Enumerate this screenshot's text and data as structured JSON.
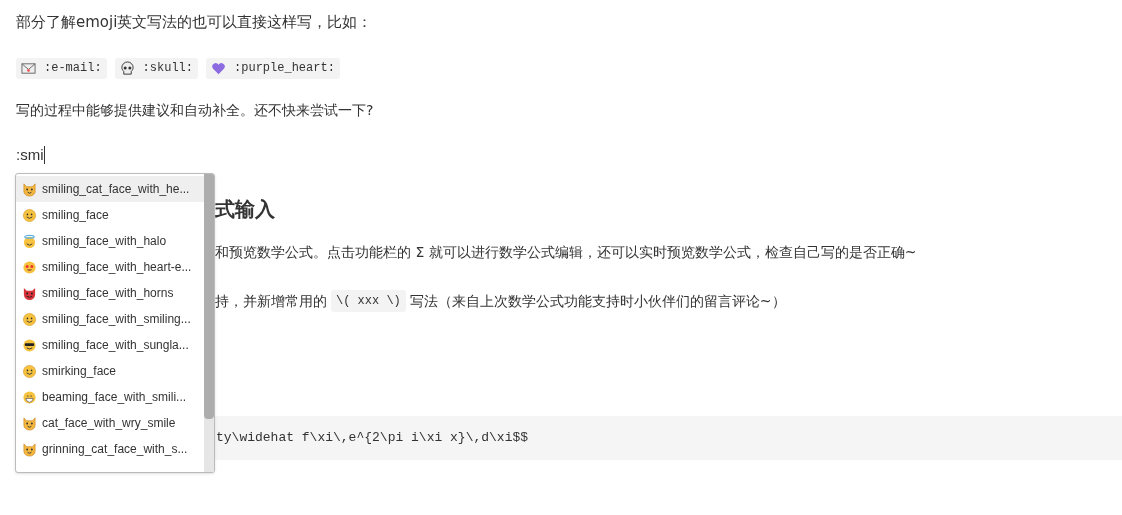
{
  "intro": "部分了解emoji英文写法的也可以直接这样写，比如：",
  "examples": [
    {
      "kind": "envelope",
      "text": ":e-mail:"
    },
    {
      "kind": "skull",
      "text": ":skull:"
    },
    {
      "kind": "heart",
      "text": ":purple_heart:"
    }
  ],
  "suggestion_note": "写的过程中能够提供建议和自动补全。还不快来尝试一下?",
  "typed": ":smi",
  "heading": "式输入",
  "paragraphs": [
    {
      "before": "和预览数学公式。点击功能栏的 Σ 就可以进行数学公式编辑，还可以实时预览数学公式，检查自己写的是否正确~"
    },
    {
      "before": "持，并新增常用的",
      "code": "\\( xxx \\)",
      "after": "写法（来自上次数学公式功能支持时小伙伴们的留言评论~）"
    }
  ],
  "code_block": "ty\\widehat f\\xi\\,e^{2\\pi i\\xi x}\\,d\\xi$$",
  "suggestions": [
    {
      "kind": "cat",
      "label": "smiling_cat_face_with_he...",
      "selected": true
    },
    {
      "kind": "face",
      "label": "smiling_face",
      "selected": false
    },
    {
      "kind": "halo",
      "label": "smiling_face_with_halo",
      "selected": false
    },
    {
      "kind": "hearteyes",
      "label": "smiling_face_with_heart-e...",
      "selected": false
    },
    {
      "kind": "devil",
      "label": "smiling_face_with_horns",
      "selected": false
    },
    {
      "kind": "face",
      "label": "smiling_face_with_smiling...",
      "selected": false
    },
    {
      "kind": "sunglasses",
      "label": "smiling_face_with_sungla...",
      "selected": false
    },
    {
      "kind": "face",
      "label": "smirking_face",
      "selected": false
    },
    {
      "kind": "grin",
      "label": "beaming_face_with_smili...",
      "selected": false
    },
    {
      "kind": "cat",
      "label": "cat_face_with_wry_smile",
      "selected": false
    },
    {
      "kind": "cat",
      "label": "grinning_cat_face_with_s...",
      "selected": false
    }
  ]
}
